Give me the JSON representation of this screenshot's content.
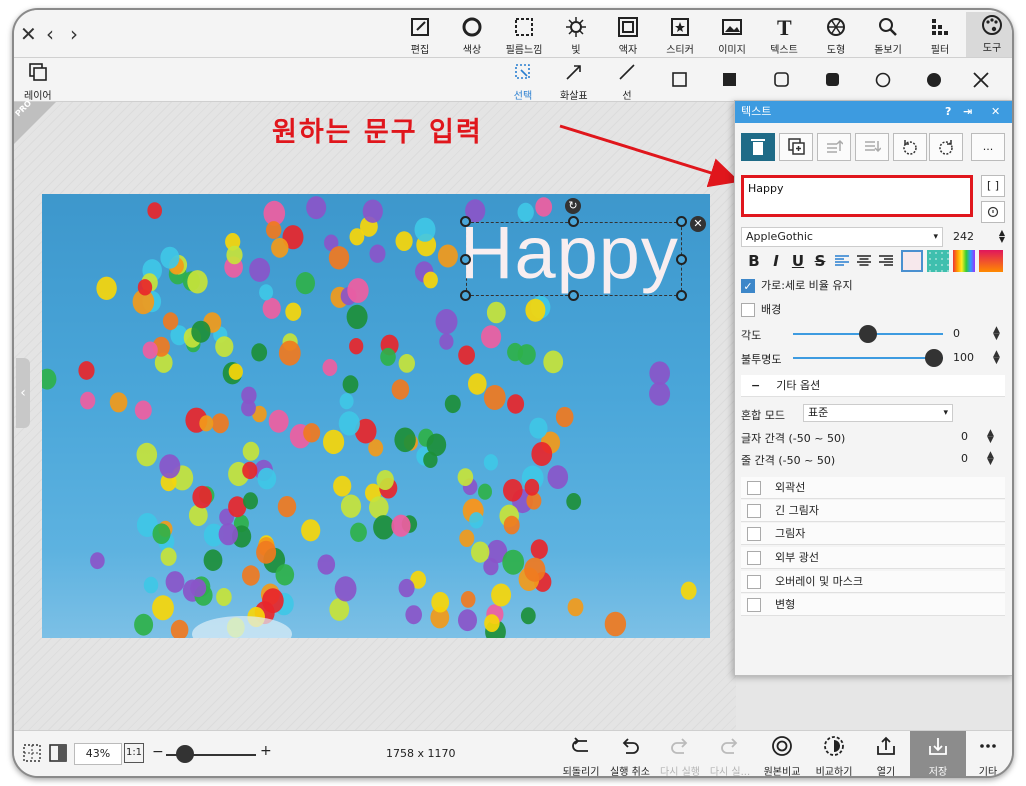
{
  "toolbar": {
    "tools": [
      {
        "label": "편집",
        "icon": "edit-icon"
      },
      {
        "label": "색상",
        "icon": "color-icon"
      },
      {
        "label": "필름느낌",
        "icon": "film-icon"
      },
      {
        "label": "빛",
        "icon": "light-icon"
      },
      {
        "label": "액자",
        "icon": "frame-icon"
      },
      {
        "label": "스티커",
        "icon": "sticker-icon"
      },
      {
        "label": "이미지",
        "icon": "image-icon"
      },
      {
        "label": "텍스트",
        "icon": "text-icon"
      },
      {
        "label": "도형",
        "icon": "shape-icon"
      },
      {
        "label": "돋보기",
        "icon": "magnifier-icon"
      },
      {
        "label": "필터",
        "icon": "filter-icon"
      },
      {
        "label": "도구",
        "icon": "palette-icon"
      }
    ]
  },
  "subbar": {
    "layer_label": "레이어",
    "select_label": "선택",
    "arrow_label": "화살표",
    "line_label": "선"
  },
  "canvas": {
    "text": "Happy",
    "pro_badge": "PRO"
  },
  "annotation": "원하는 문구 입력",
  "panel": {
    "title": "텍스트",
    "text_value": "Happy",
    "more_label": "...",
    "bracket_label": "[ ]",
    "font": "AppleGothic",
    "font_size": "242",
    "keep_ratio_label": "가로:세로 비율 유지",
    "background_label": "배경",
    "angle_label": "각도",
    "angle_value": "0",
    "opacity_label": "불투명도",
    "opacity_value": "100",
    "opacity_fraction": 1.0,
    "angle_fraction": 0.5,
    "other_options_label": "기타 옵션",
    "blend_mode_label": "혼합 모드",
    "blend_mode_value": "표준",
    "letter_spacing_label": "글자 간격 (-50 ~ 50)",
    "letter_spacing_value": "0",
    "line_spacing_label": "줄 간격 (-50 ~ 50)",
    "line_spacing_value": "0",
    "effects": [
      "외곽선",
      "긴 그림자",
      "그림자",
      "외부 광선",
      "오버레이 및 마스크",
      "변형"
    ]
  },
  "bottom": {
    "zoom": "43%",
    "one_to_one": "1:1",
    "dimensions": "1758 x 1170",
    "actions": [
      {
        "label": "되돌리기",
        "icon": "revert-icon",
        "enabled": true
      },
      {
        "label": "실행 취소",
        "icon": "undo-icon",
        "enabled": true
      },
      {
        "label": "다시 실행",
        "icon": "redo-icon",
        "enabled": false
      },
      {
        "label": "다시 실...",
        "icon": "redo-all-icon",
        "enabled": false
      },
      {
        "label": "원본비교",
        "icon": "compare-original-icon",
        "enabled": true
      },
      {
        "label": "비교하기",
        "icon": "compare-icon",
        "enabled": true
      },
      {
        "label": "열기",
        "icon": "open-icon",
        "enabled": true
      },
      {
        "label": "저장",
        "icon": "save-icon",
        "enabled": true
      },
      {
        "label": "기타",
        "icon": "more-icon",
        "enabled": true
      }
    ]
  }
}
